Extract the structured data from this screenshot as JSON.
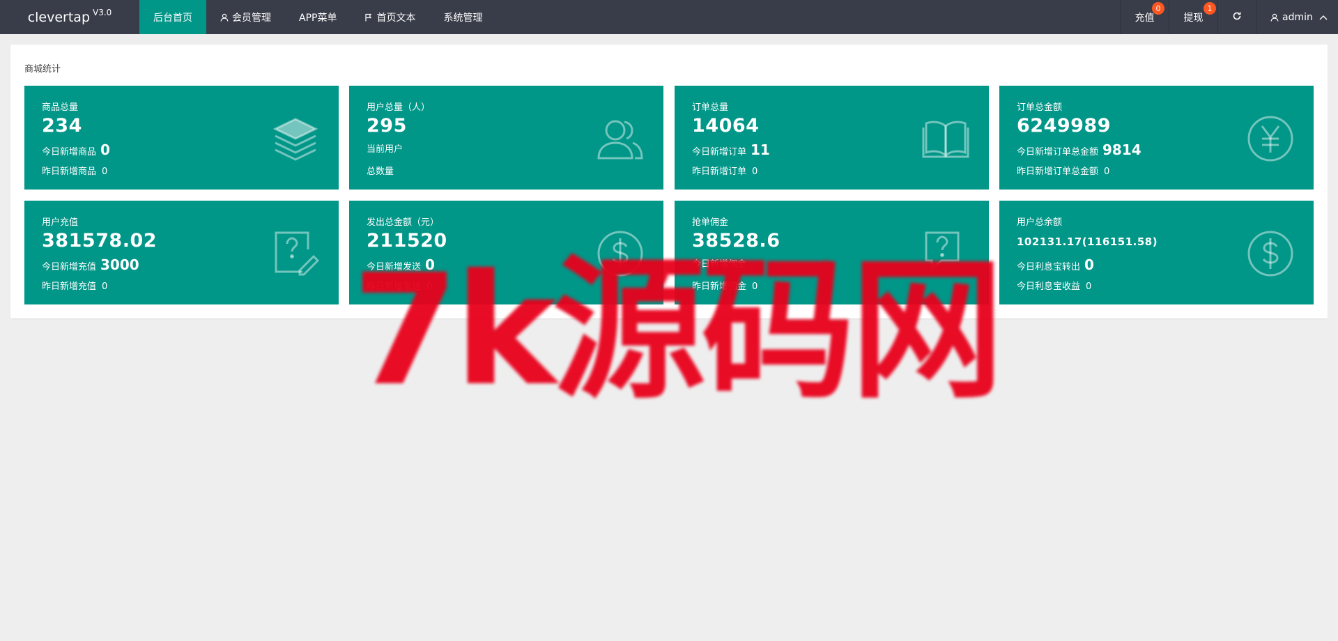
{
  "brand": {
    "name": "clevertap",
    "version": "V3.0"
  },
  "nav": {
    "items": [
      {
        "label": "后台首页",
        "active": true,
        "icon": ""
      },
      {
        "label": "会员管理",
        "active": false,
        "icon": "user-icon"
      },
      {
        "label": "APP菜单",
        "active": false,
        "icon": ""
      },
      {
        "label": "首页文本",
        "active": false,
        "icon": "flag-icon"
      },
      {
        "label": "系统管理",
        "active": false,
        "icon": ""
      }
    ],
    "right": {
      "recharge": {
        "label": "充值",
        "badge": "0"
      },
      "withdraw": {
        "label": "提现",
        "badge": "1"
      },
      "refresh_icon": "refresh-icon",
      "user": {
        "label": "admin",
        "icon": "user-icon",
        "caret": "chevron-up-icon"
      }
    }
  },
  "panel": {
    "title": "商城统计",
    "tiles": [
      {
        "title": "商品总量",
        "value": "234",
        "line1_label": "今日新增商品",
        "line1_value": "0",
        "line2_label": "昨日新增商品",
        "line2_value": "0",
        "icon": "layers-icon"
      },
      {
        "title": "用户总量（人）",
        "value": "295",
        "line1_label": "当前用户",
        "line1_value": "",
        "line2_label": "总数量",
        "line2_value": "",
        "icon": "users-icon"
      },
      {
        "title": "订单总量",
        "value": "14064",
        "line1_label": "今日新增订单",
        "line1_value": "11",
        "line2_label": "昨日新增订单",
        "line2_value": "0",
        "icon": "book-icon"
      },
      {
        "title": "订单总金额",
        "value": "6249989",
        "line1_label": "今日新增订单总金额",
        "line1_value": "9814",
        "line2_label": "昨日新增订单总金额",
        "line2_value": "0",
        "icon": "yen-icon"
      },
      {
        "title": "用户充值",
        "value": "381578.02",
        "line1_label": "今日新增充值",
        "line1_value": "3000",
        "line2_label": "昨日新增充值",
        "line2_value": "0",
        "icon": "question-edit-icon"
      },
      {
        "title": "发出总金额（元）",
        "value": "211520",
        "line1_label": "今日新增发送",
        "line1_value": "0",
        "line2_label": "昨日新增发送",
        "line2_value": "0",
        "icon": "dollar-icon"
      },
      {
        "title": "抢单佣金",
        "value": "38528.6",
        "line1_label": "今日新增佣金",
        "line1_value": "",
        "line2_label": "昨日新增佣金",
        "line2_value": "0",
        "icon": "question-chat-icon"
      },
      {
        "title": "用户总余额",
        "value": "102131.17(116151.58)",
        "line1_label": "今日利息宝转出",
        "line1_value": "0",
        "line2_label": "今日利息宝收益",
        "line2_value": "0",
        "icon": "dollar-icon"
      }
    ]
  },
  "watermark": {
    "text": "7k源码网",
    "color": "#e8001b"
  },
  "colors": {
    "topbar": "#393d49",
    "accent": "#009688",
    "badge": "#ff5722",
    "background": "#eeeeee"
  }
}
